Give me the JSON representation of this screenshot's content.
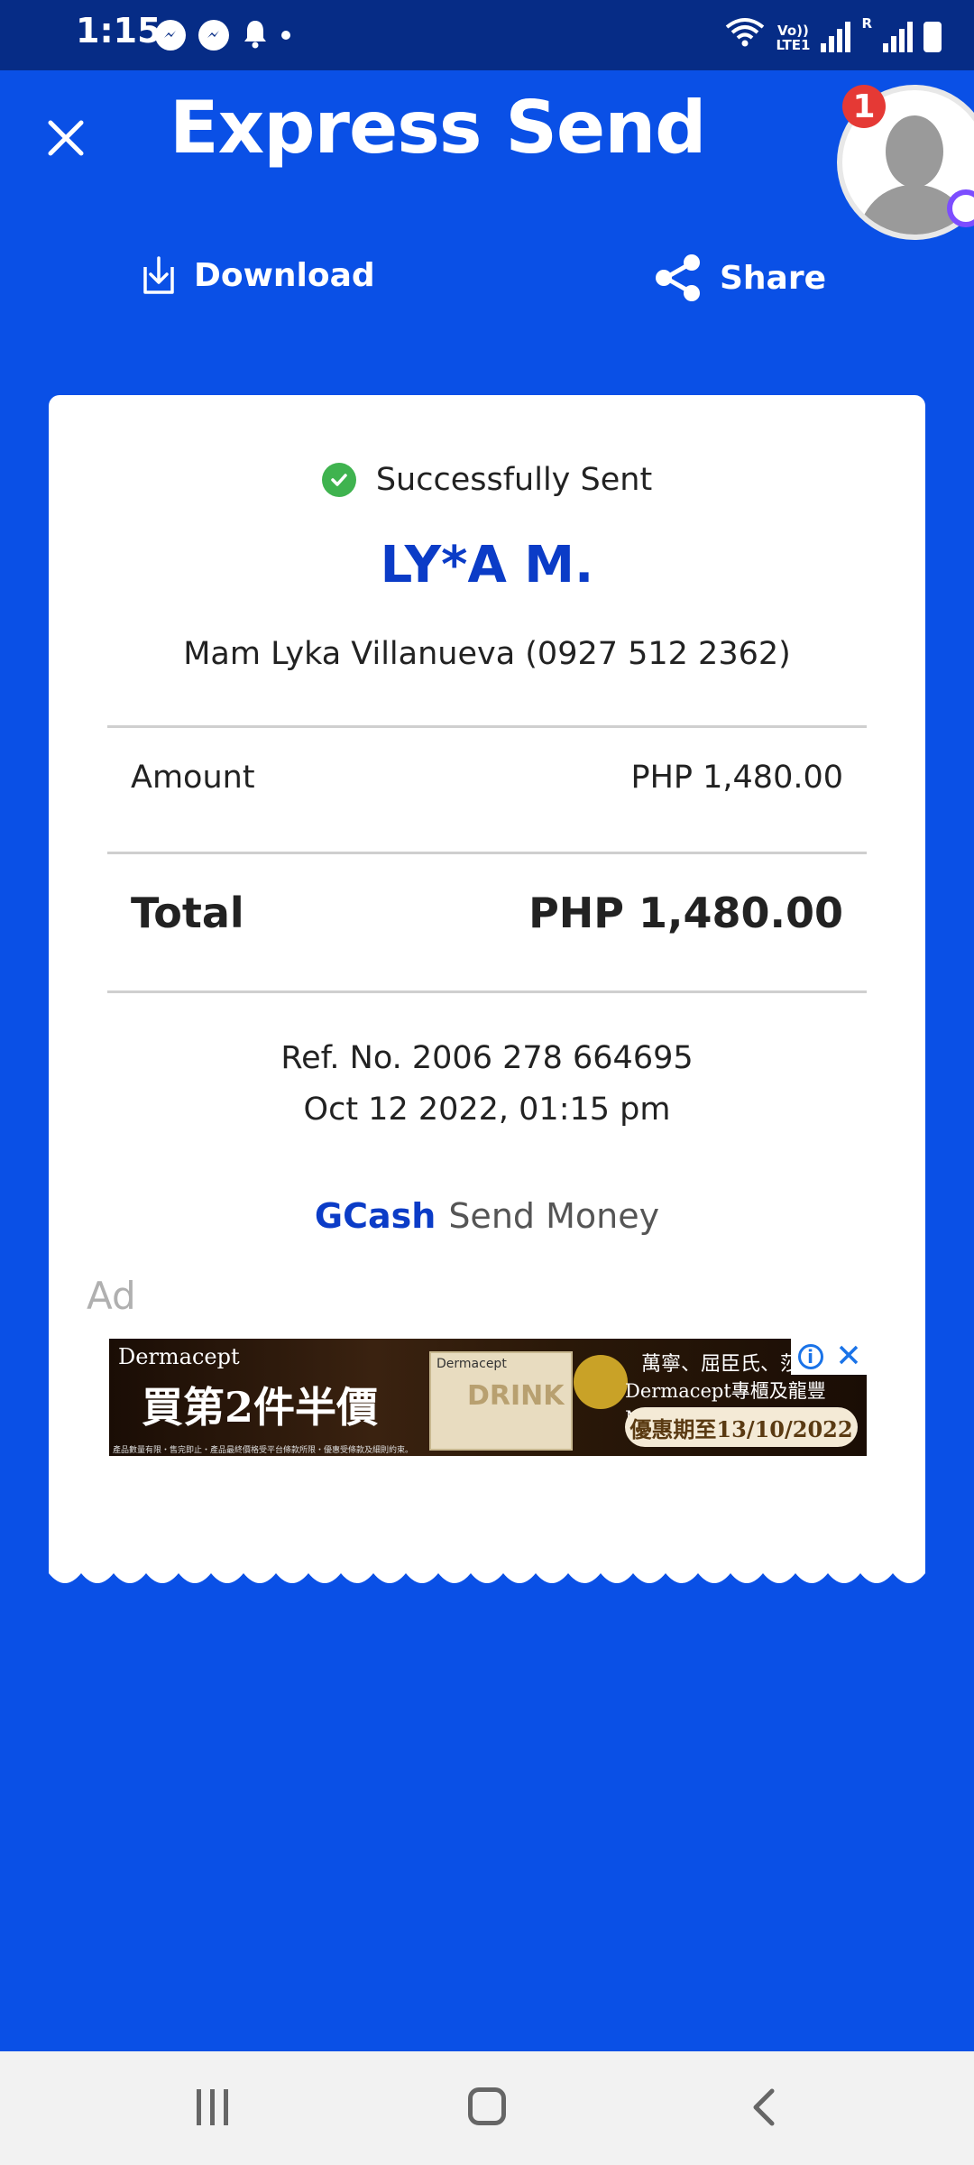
{
  "status_bar": {
    "time": "1:15",
    "lte_label": "LTE1",
    "volte_label": "Vo))",
    "roaming_label": "R"
  },
  "header": {
    "title": "Express Send",
    "notification_count": "1",
    "download_label": "Download",
    "share_label": "Share"
  },
  "receipt": {
    "status": "Successfully Sent",
    "recipient_masked": "LY*A M.",
    "contact": "Mam Lyka Villanueva (0927 512 2362)",
    "amount_label": "Amount",
    "amount_value": "PHP 1,480.00",
    "total_label": "Total",
    "total_value": "PHP 1,480.00",
    "ref": "Ref. No. 2006 278 664695",
    "datetime": "Oct 12 2022, 01:15 pm",
    "brand_name": "GCash",
    "brand_service": "Send Money"
  },
  "ad": {
    "label": "Ad",
    "brand": "Dermacept",
    "headline": "買第2件半價",
    "product_small": "Dermacept",
    "product_big": "DRINK",
    "right_line1": "萬寧、屈臣氏、莎莎",
    "right_line2": "Dermacept專櫃及龍豐Mall有售",
    "promo": "優惠期至13/10/2022",
    "fine_print": "產品數量有限・售完即止・產品最終價格受平台條款所限・優惠受條款及細則約束。"
  },
  "colors": {
    "background": "#0a50e6",
    "status_bar": "#062c86",
    "accent_text": "#0b3cc7",
    "success": "#3fb34f",
    "badge": "#e53935"
  }
}
